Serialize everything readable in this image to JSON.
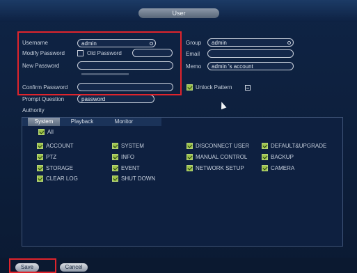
{
  "window": {
    "title": "User"
  },
  "form": {
    "username_label": "Username",
    "username_value": "admin",
    "modify_password_label": "Modify Password",
    "old_password_label": "Old Password",
    "new_password_label": "New Password",
    "confirm_password_label": "Confirm Password",
    "prompt_question_label": "Prompt Question",
    "prompt_question_value": "password",
    "group_label": "Group",
    "group_value": "admin",
    "email_label": "Email",
    "memo_label": "Memo",
    "memo_value": "admin 's account",
    "unlock_pattern_label": "Unlock Pattern",
    "modify_password_checked": false,
    "unlock_pattern_checked": true
  },
  "authority": {
    "label": "Authority",
    "tabs": [
      {
        "label": "System",
        "active": true
      },
      {
        "label": "Playback",
        "active": false
      },
      {
        "label": "Monitor",
        "active": false
      }
    ],
    "all_label": "All",
    "permissions": [
      {
        "label": "ACCOUNT",
        "checked": true
      },
      {
        "label": "SYSTEM",
        "checked": true
      },
      {
        "label": "DISCONNECT USER",
        "checked": true
      },
      {
        "label": "DEFAULT&UPGRADE",
        "checked": true
      },
      {
        "label": "PTZ",
        "checked": true
      },
      {
        "label": "INFO",
        "checked": true
      },
      {
        "label": "MANUAL CONTROL",
        "checked": true
      },
      {
        "label": "BACKUP",
        "checked": true
      },
      {
        "label": "STORAGE",
        "checked": true
      },
      {
        "label": "EVENT",
        "checked": true
      },
      {
        "label": "NETWORK SETUP",
        "checked": true
      },
      {
        "label": "CAMERA",
        "checked": true
      },
      {
        "label": "CLEAR LOG",
        "checked": true
      },
      {
        "label": "SHUT DOWN",
        "checked": true
      }
    ]
  },
  "footer": {
    "save_label": "Save",
    "cancel_label": "Cancel"
  },
  "colors": {
    "highlight": "#e0242c",
    "check": "#9dc24a",
    "background": "#0c1d38"
  }
}
